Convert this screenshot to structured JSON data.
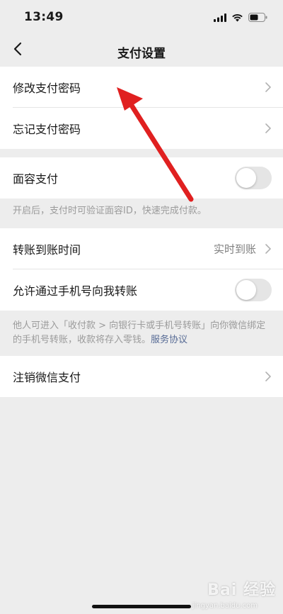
{
  "status_bar": {
    "time": "13:49",
    "icons": [
      "signal-icon",
      "wifi-icon",
      "battery-icon"
    ]
  },
  "nav": {
    "title": "支付设置",
    "back_icon": "chevron-left-icon"
  },
  "group_password": {
    "items": [
      {
        "label": "修改支付密码"
      },
      {
        "label": "忘记支付密码"
      }
    ]
  },
  "group_face": {
    "label": "面容支付",
    "toggle_on": false,
    "hint": "开启后，支付时可验证面容ID，快速完成付款。"
  },
  "group_transfer": {
    "arrival_time": {
      "label": "转账到账时间",
      "value": "实时到账"
    },
    "phone_transfer": {
      "label": "允许通过手机号向我转账",
      "toggle_on": false
    },
    "hint": "他人可进入「收付款 > 向银行卡或手机号转账」向你微信绑定的手机号转账，收款将存入零钱。",
    "hint_link": "服务协议"
  },
  "group_cancel": {
    "label": "注销微信支付"
  },
  "watermark": {
    "main": "Bai 经验",
    "sub": "jingyan.baidu.com"
  },
  "colors": {
    "background": "#ededed",
    "arrow": "#e02020",
    "link": "#576b95"
  }
}
